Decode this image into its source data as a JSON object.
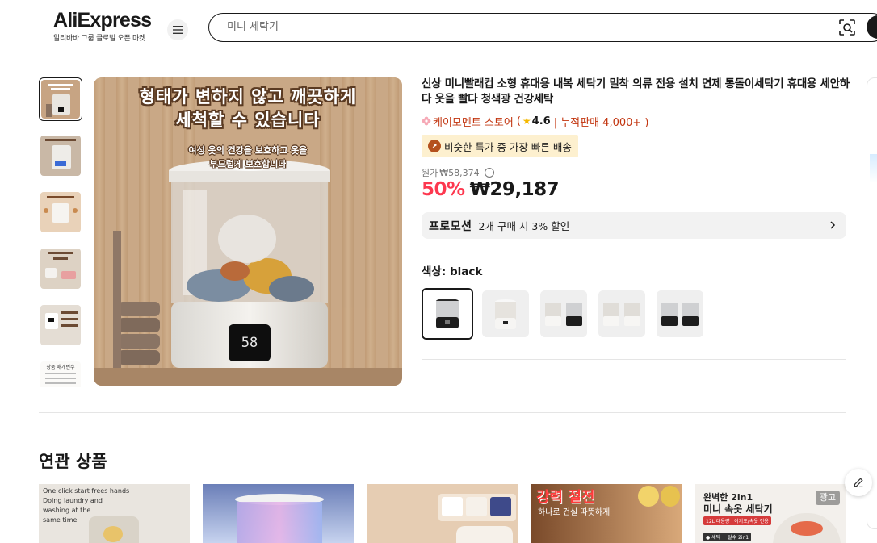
{
  "header": {
    "logo_text": "AliExpress",
    "logo_tagline": "알리바바 그룹 글로벌 오픈 마켓",
    "search_placeholder": "미니 세탁기"
  },
  "gallery": {
    "headline_line1": "형태가 변하지 않고 깨끗하게",
    "headline_line2": "세척할 수 있습니다",
    "subline1": "여성 옷의 건강을 보호하고 옷을",
    "subline2": "부드럽게 보호합니다",
    "display_value": "58",
    "thumb_caption": "상품 매개변수"
  },
  "product": {
    "title": "신상 미니빨래컵 소형 휴대용 내복 세탁기 밀착 의류 전용 설치 면제 통돌이세탁기 휴대용 세안하다 옷을 빨다 청색광 건강세탁",
    "store_name": "케이모멘트 스토어",
    "rating_open": "(",
    "rating": "4.6",
    "sold": "| 누적판매 4,000+ )",
    "delivery_badge": "비슷한 특가 중 가장 빠른 배송",
    "original_label": "원가",
    "original_price": "₩58,374",
    "discount": "50%",
    "price": "₩29,187",
    "promo_label": "프로모션",
    "promo_text": "2개 구매 시 3% 할인",
    "color_label": "색상: black",
    "selected_color": "black"
  },
  "related": {
    "title": "연관 상품",
    "card1_text1": "One click start frees hands",
    "card1_text2": "Doing laundry and",
    "card1_text3": "washing at the",
    "card1_text4": "same time",
    "card4_text1": "강력 절전",
    "card4_text2": "하나로 건실 따뜻하게",
    "card5_text1": "완벽한 2in1",
    "card5_text2": "미니 속옷 세탁기",
    "card5_text3": "12L 대용량 · 이기포/속옷 전용",
    "card5_text4": "● 세탁 + 탈수 2in1",
    "ad_label": "광고"
  },
  "colors": {
    "accent_red": "#fd384f",
    "store_orange": "#c2340e",
    "badge_bg": "#fdf0cf"
  }
}
